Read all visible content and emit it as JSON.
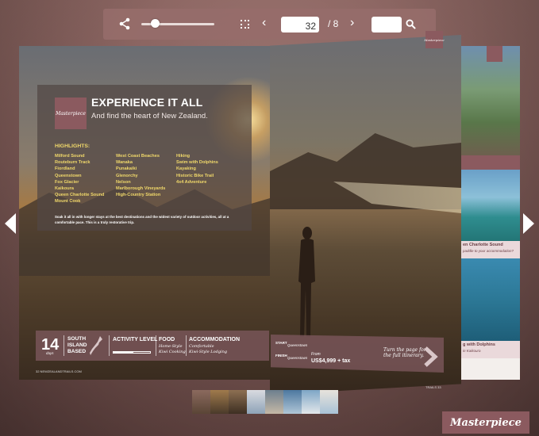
{
  "toolbar": {
    "share_icon": "share-icon",
    "fullscreen_icon": "fullscreen-icon",
    "prev_icon": "chevron-left-icon",
    "next_icon": "chevron-right-icon",
    "search_icon": "search-icon",
    "current_page": "32",
    "total_pages": "/ 8",
    "zoom_level": 0.18,
    "search_placeholder": ""
  },
  "nav": {
    "left_arrow": "arrow-left-icon",
    "right_arrow": "arrow-right-icon"
  },
  "spread": {
    "logo_text": "Masterpiece",
    "headline": "EXPERIENCE IT ALL",
    "subhead": "And find the heart of New Zealand.",
    "highlights_title": "HIGHLIGHTS:",
    "highlights_col1": [
      "Milford Sound",
      "Routeburn Track",
      "Fiordland",
      "Queenstown",
      "Fox Glacier",
      "Kaikoura",
      "Queen Charlotte Sound",
      "Mount Cook"
    ],
    "highlights_col2": [
      "West Coast Beaches",
      "Wanaka",
      "Punakaiki",
      "Glenorchy",
      "Nelson",
      "Marlborough Vineyards",
      "High-Country Station"
    ],
    "highlights_col3": [
      "Hiking",
      "Swim with Dolphins",
      "Kayaking",
      "Historic Bike Trail",
      "4x4 Adventure"
    ],
    "blurb": "Soak it all in with longer stays at the best destinations and the widest variety of outdoor activities, all at a comfortable pace. This is a truly restorative trip.",
    "days_num": "14",
    "days_label": "days",
    "region": "SOUTH ISLAND BASED",
    "activity_label": "ACTIVITY LEVEL",
    "activity_level": 0.55,
    "food_label": "FOOD",
    "food_value_1": "Home-Style",
    "food_value_2": "Kiwi Cooking",
    "accommodation_label": "ACCOMMODATION",
    "accommodation_value_1": "Comfortable",
    "accommodation_value_2": "Kiwi-Style Lodging",
    "start_label": "START",
    "start_value": "Queenstown",
    "finish_label": "FINISH",
    "finish_value": "Queenstown",
    "from_label": "From",
    "price": "US$4,999 + tax",
    "turn_text": "Turn the page for the full itinerary.",
    "footer_left": "32 NEWZEALANDTRAILS.COM",
    "footer_right": "TRAILS 33",
    "tab_right": "Masterpiece"
  },
  "peek": {
    "caption1_title": "en Charlotte Sound",
    "caption1_sub": "paddle to your accommodation?",
    "caption2_title": "g with Dolphins",
    "caption2_sub": "in Kaikoura"
  },
  "brand": {
    "badge": "Masterpiece"
  }
}
